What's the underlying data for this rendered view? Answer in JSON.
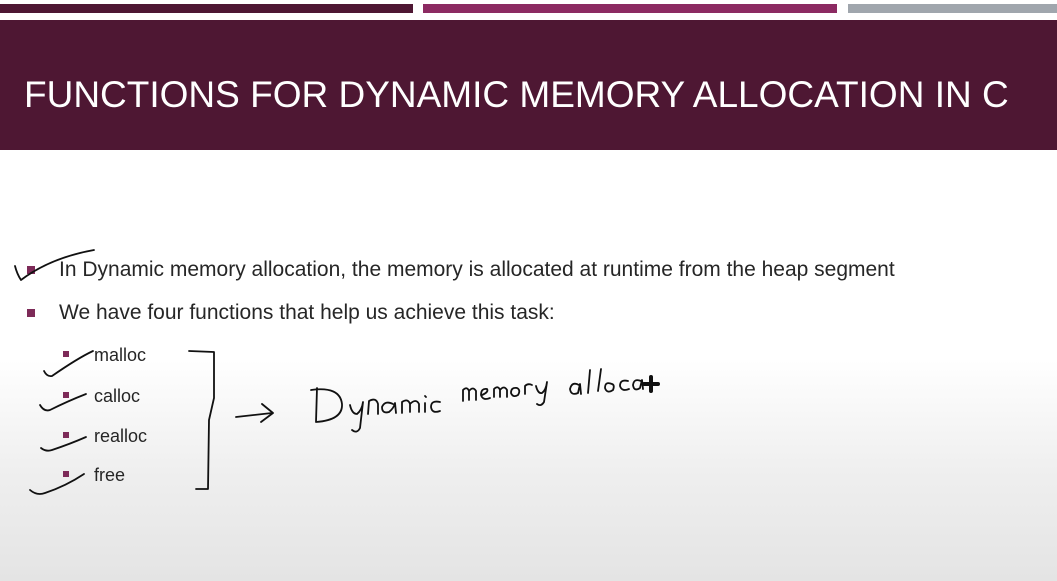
{
  "slide": {
    "title": "FUNCTIONS FOR DYNAMIC MEMORY ALLOCATION IN C",
    "bullets": [
      "In Dynamic memory allocation, the memory is allocated at runtime from the heap segment",
      "We have four functions that help us achieve this task:"
    ],
    "sub_bullets": [
      "malloc",
      "calloc",
      "realloc",
      "free"
    ],
    "handwritten_note": "Dynamic memory allocat"
  },
  "colors": {
    "title_band": "#4e1733",
    "bar_dark": "#4e1733",
    "bar_accent": "#8c2a62",
    "bar_gray": "#a0a6ad",
    "bullet_marker": "#7d2a58",
    "ink": "#111111"
  }
}
